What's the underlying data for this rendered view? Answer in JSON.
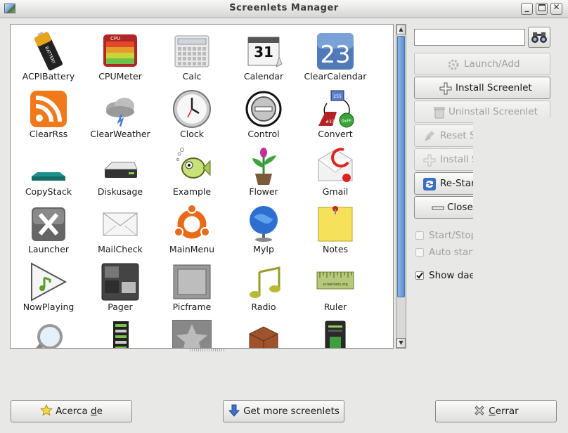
{
  "window": {
    "title": "Screenlets Manager"
  },
  "grid": {
    "items": [
      {
        "label": "ACPIBattery",
        "icon": "battery-icon"
      },
      {
        "label": "CPUMeter",
        "icon": "cpu-meter-icon"
      },
      {
        "label": "Calc",
        "icon": "calculator-icon"
      },
      {
        "label": "Calendar",
        "icon": "calendar-icon",
        "text": "31"
      },
      {
        "label": "ClearCalendar",
        "icon": "clear-calendar-icon",
        "text": "23"
      },
      {
        "label": "ClearRss",
        "icon": "rss-icon"
      },
      {
        "label": "ClearWeather",
        "icon": "weather-icon"
      },
      {
        "label": "Clock",
        "icon": "clock-icon"
      },
      {
        "label": "Control",
        "icon": "control-icon"
      },
      {
        "label": "Convert",
        "icon": "convert-icon",
        "text": [
          "255",
          "#377",
          "0xFF"
        ]
      },
      {
        "label": "CopyStack",
        "icon": "copystack-icon"
      },
      {
        "label": "Diskusage",
        "icon": "disk-icon"
      },
      {
        "label": "Example",
        "icon": "fish-icon"
      },
      {
        "label": "Flower",
        "icon": "flower-icon"
      },
      {
        "label": "Gmail",
        "icon": "gmail-icon"
      },
      {
        "label": "Launcher",
        "icon": "launcher-icon"
      },
      {
        "label": "MailCheck",
        "icon": "envelope-icon"
      },
      {
        "label": "MainMenu",
        "icon": "ubuntu-icon"
      },
      {
        "label": "MyIp",
        "icon": "globe-icon"
      },
      {
        "label": "Notes",
        "icon": "note-icon"
      },
      {
        "label": "NowPlaying",
        "icon": "play-icon"
      },
      {
        "label": "Pager",
        "icon": "pager-icon"
      },
      {
        "label": "Picframe",
        "icon": "picframe-icon"
      },
      {
        "label": "Radio",
        "icon": "music-note-icon"
      },
      {
        "label": "Ruler",
        "icon": "ruler-icon",
        "text": "screenlets.org"
      },
      {
        "label": "",
        "icon": "magnifier-icon"
      },
      {
        "label": "",
        "icon": "meter-icon"
      },
      {
        "label": "",
        "icon": "star-frame-icon"
      },
      {
        "label": "",
        "icon": "box-icon"
      },
      {
        "label": "",
        "icon": "computer-tower-icon"
      }
    ]
  },
  "sidebar": {
    "search": {
      "value": "",
      "placeholder": ""
    },
    "buttons": {
      "launch": "Launch/Add",
      "install": "Install Screenlet",
      "uninstall": "Uninstall Screenlet",
      "reset": "Reset S",
      "install2": "Install S",
      "restart": "Re-Star",
      "close": "Close"
    },
    "checks": {
      "startstop": "Start/Stop",
      "autostart": "Auto start",
      "daemon": "Show dae"
    }
  },
  "footer": {
    "about": "Acerca de",
    "more": "Get more screenlets",
    "close": "Cerrar"
  },
  "colors": {
    "accent": "#5d8fd3",
    "window_bg": "#e8e8e7"
  }
}
